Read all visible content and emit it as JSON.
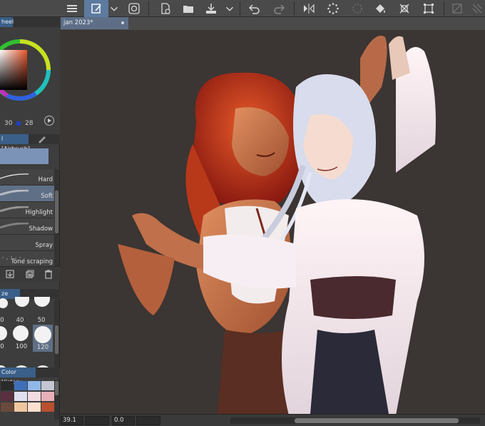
{
  "toolbar": {
    "icons": [
      "menu-icon",
      "brush-tool-icon",
      "chevron-down-icon",
      "spiral-icon",
      "new-file-icon",
      "open-folder-icon",
      "save-icon",
      "chevron-down-icon",
      "undo-icon",
      "redo-icon",
      "flip-icon",
      "loading-icon",
      "dotted-circle-icon",
      "fill-bucket-icon",
      "transform-icon",
      "crop-icon",
      "hide-icon",
      "hatch-icon"
    ]
  },
  "color_wheel": {
    "tab_label": "heel",
    "value_left": "30",
    "value_right": "28",
    "picker_accent": "#2040c0"
  },
  "brush_panel": {
    "tab_label": "l [Airbrush]",
    "items": [
      {
        "label": "Hard"
      },
      {
        "label": "Soft",
        "selected": true
      },
      {
        "label": "Highlight"
      },
      {
        "label": "Shadow"
      },
      {
        "label": "Spray"
      },
      {
        "label": "Tone scraping"
      }
    ]
  },
  "size_panel": {
    "tab_label": "ze [Soft]",
    "sizes": [
      {
        "label": "0"
      },
      {
        "label": "40"
      },
      {
        "label": "50"
      },
      {
        "label": "0"
      },
      {
        "label": "100"
      },
      {
        "label": "120",
        "selected": true
      },
      {
        "label": ""
      },
      {
        "label": ""
      },
      {
        "label": ""
      }
    ]
  },
  "color_history": {
    "tab_label": "Color History",
    "swatches": [
      "#2b2b2b",
      "#3f6fb8",
      "#8fb8e8",
      "#c4c6d2",
      "#5a2f3f",
      "#e0e0f0",
      "#f3dbe2",
      "#e8b0b8",
      "#6a4a3a",
      "#f0c8a0",
      "#ffe0d0",
      "#b85030"
    ]
  },
  "document": {
    "tab_label": "jan 2023*"
  },
  "status": {
    "zoom": "39.1",
    "rotation": "0.0"
  }
}
